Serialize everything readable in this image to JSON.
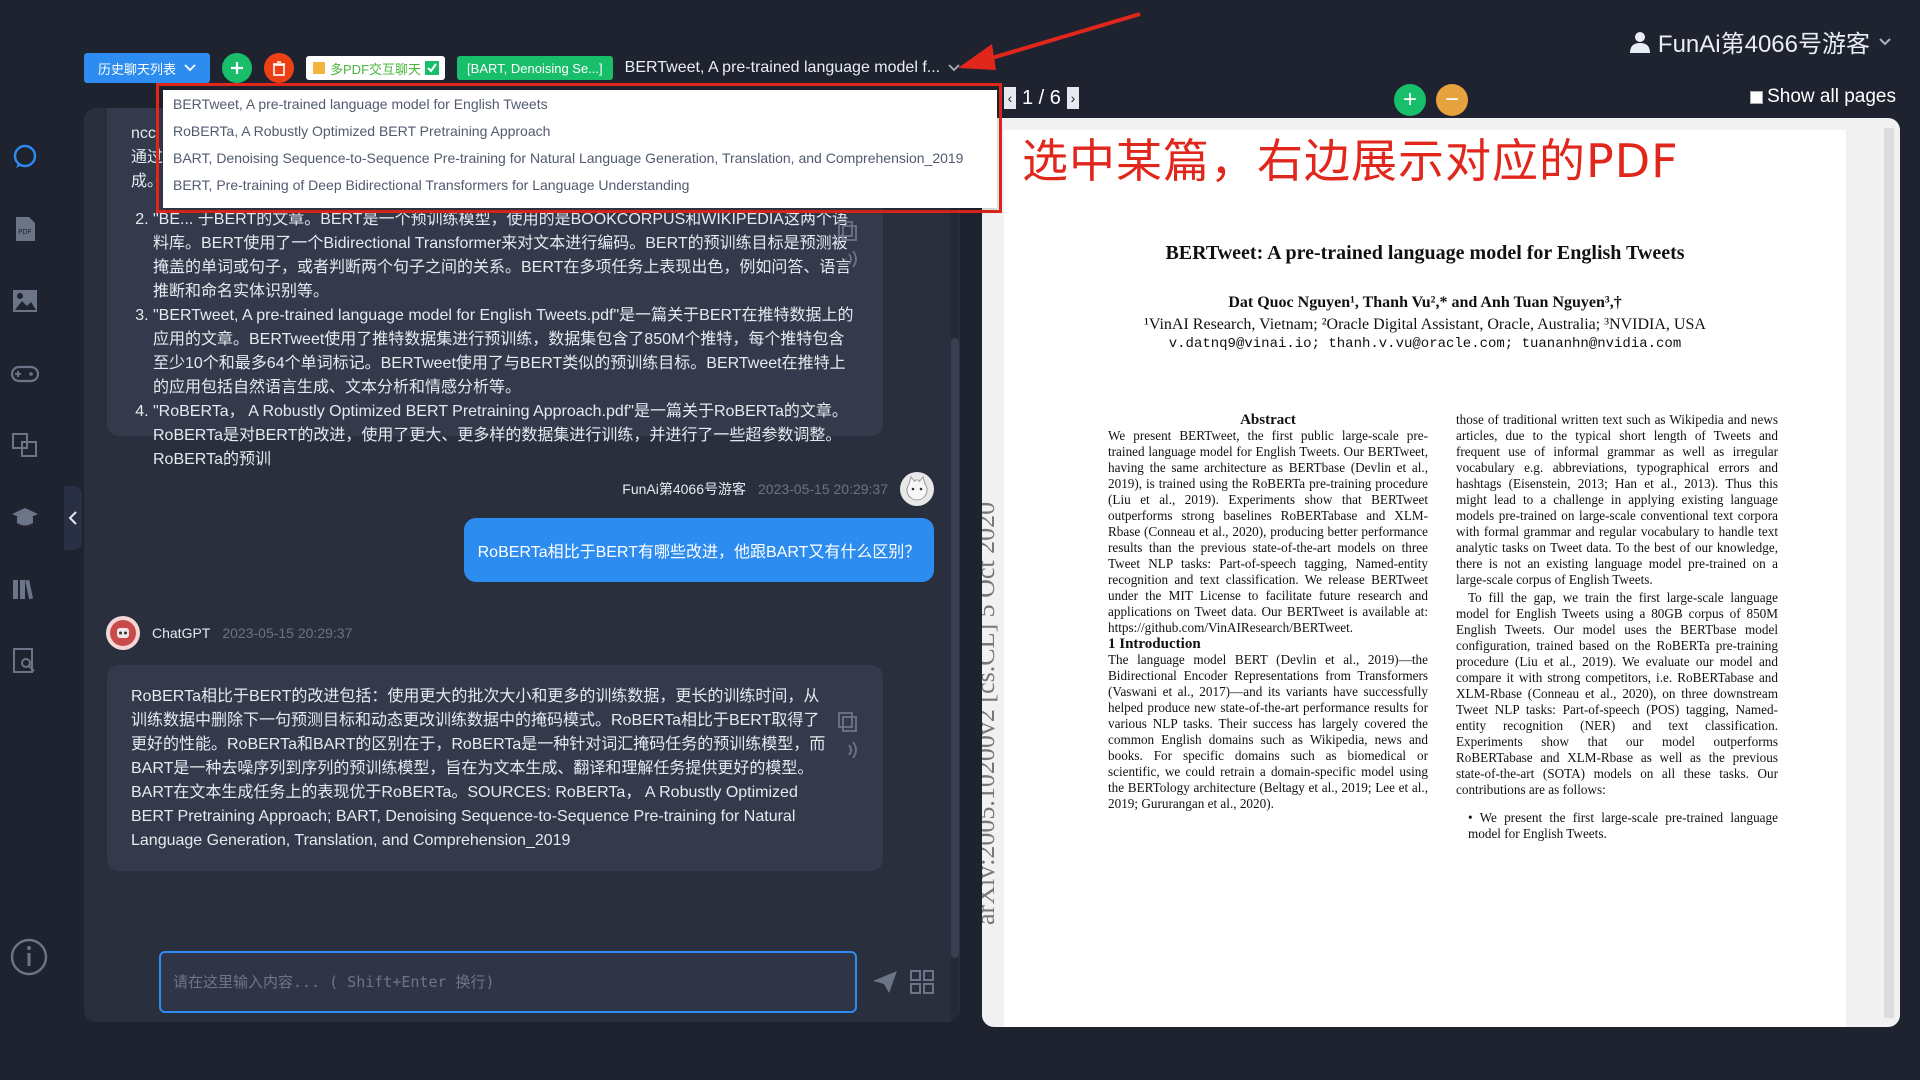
{
  "user": {
    "name": "FunAi第4066号游客"
  },
  "toolbar": {
    "history_label": "历史聊天列表",
    "tag_multi": "多PDF交互聊天",
    "tag_selected": "[BART, Denoising Se...]",
    "select_value": "BERTweet, A pre-trained language model f..."
  },
  "dropdown": {
    "options": [
      "BERTweet, A pre-trained language model for English Tweets",
      "RoBERTa,  A Robustly Optimized BERT Pretraining Approach",
      "BART, Denoising Sequence-to-Sequence Pre-training for Natural Language Generation, Translation, and Comprehension_2019",
      "BERT, Pre-training of Deep Bidirectional Transformers for Language Understanding"
    ]
  },
  "annotation": "选中某篇，右边展示对应的PDF",
  "chat": {
    "top_bubble_lines": [
      "ncc",
      "通过",
      "成。"
    ],
    "list_items": [
      "\"BE... 于BERT的文章。BERT是一个预训练模型，使用的是BOOKCORPUS和WIKIPEDIA这两个语料库。BERT使用了一个Bidirectional Transformer来对文本进行编码。BERT的预训练目标是预测被掩盖的单词或句子，或者判断两个句子之间的关系。BERT在多项任务上表现出色，例如问答、语言推断和命名实体识别等。",
      "\"BERTweet, A pre-trained language model for English Tweets.pdf\"是一篇关于BERT在推特数据上的应用的文章。BERTweet使用了推特数据集进行预训练，数据集包含了850M个推特，每个推特包含至少10个和最多64个单词标记。BERTweet使用了与BERT类似的预训练目标。BERTweet在推特上的应用包括自然语言生成、文本分析和情感分析等。",
      "\"RoBERTa， A Robustly Optimized BERT Pretraining Approach.pdf\"是一篇关于RoBERTa的文章。RoBERTa是对BERT的改进，使用了更大、更多样的数据集进行训练，并进行了一些超参数调整。RoBERTa的预训"
    ],
    "user_name": "FunAi第4066号游客",
    "user_time": "2023-05-15 20:29:37",
    "user_message": "RoBERTa相比于BERT有哪些改进，他跟BART又有什么区别？",
    "bot_name": "ChatGPT",
    "bot_time": "2023-05-15 20:29:37",
    "bot_message": "RoBERTa相比于BERT的改进包括：使用更大的批次大小和更多的训练数据，更长的训练时间，从训练数据中删除下一句预测目标和动态更改训练数据中的掩码模式。RoBERTa相比于BERT取得了更好的性能。RoBERTa和BART的区别在于，RoBERTa是一种针对词汇掩码任务的预训练模型，而BART是一种去噪序列到序列的预训练模型，旨在为文本生成、翻译和理解任务提供更好的模型。BART在文本生成任务上的表现优于RoBERTa。SOURCES: RoBERTa， A Robustly Optimized BERT Pretraining Approach; BART, Denoising Sequence-to-Sequence Pre-training for Natural Language Generation, Translation, and Comprehension_2019",
    "input_placeholder": "请在这里输入内容... ( Shift+Enter 换行)"
  },
  "pdf": {
    "page_indicator": "1 / 6",
    "show_all_label": "Show all pages",
    "title": "BERTweet: A pre-trained language model for English Tweets",
    "authors": "Dat Quoc Nguyen¹, Thanh Vu²,* and Anh Tuan Nguyen³,†",
    "affiliations": "¹VinAI Research, Vietnam; ²Oracle Digital Assistant, Oracle, Australia; ³NVIDIA, USA",
    "emails": "v.datnq9@vinai.io; thanh.v.vu@oracle.com; tuananhn@nvidia.com",
    "arxiv_id": "arXiv:2005.10200v2  [cs.CL]  5 Oct 2020",
    "abstract_heading": "Abstract",
    "abstract_text": "We present BERTweet, the first public large-scale pre-trained language model for English Tweets. Our BERTweet, having the same architecture as BERTbase (Devlin et al., 2019), is trained using the RoBERTa pre-training procedure (Liu et al., 2019). Experiments show that BERTweet outperforms strong baselines RoBERTabase and XLM-Rbase (Conneau et al., 2020), producing better performance results than the previous state-of-the-art models on three Tweet NLP tasks: Part-of-speech tagging, Named-entity recognition and text classification. We release BERTweet under the MIT License to facilitate future research and applications on Tweet data. Our BERTweet is available at: https://github.com/VinAIResearch/BERTweet.",
    "intro_heading": "1   Introduction",
    "intro_text": "The language model BERT (Devlin et al., 2019)—the Bidirectional Encoder Representations from Transformers (Vaswani et al., 2017)—and its variants have successfully helped produce new state-of-the-art performance results for various NLP tasks. Their success has largely covered the common English domains such as Wikipedia, news and books. For specific domains such as biomedical or scientific, we could retrain a domain-specific model using the BERTology architecture (Beltagy et al., 2019; Lee et al., 2019; Gururangan et al., 2020).",
    "right_col_1": "those of traditional written text such as Wikipedia and news articles, due to the typical short length of Tweets and frequent use of informal grammar as well as irregular vocabulary e.g. abbreviations, typographical errors and hashtags (Eisenstein, 2013; Han et al., 2013). Thus this might lead to a challenge in applying existing language models pre-trained on large-scale conventional text corpora with formal grammar and regular vocabulary to handle text analytic tasks on Tweet data. To the best of our knowledge, there is not an existing language model pre-trained on a large-scale corpus of English Tweets.",
    "right_col_2": "To fill the gap, we train the first large-scale language model for English Tweets using a 80GB corpus of 850M English Tweets. Our model uses the BERTbase model configuration, trained based on the RoBERTa pre-training procedure (Liu et al., 2019). We evaluate our model and compare it with strong competitors, i.e. RoBERTabase and XLM-Rbase (Conneau et al., 2020), on three downstream Tweet NLP tasks: Part-of-speech (POS) tagging, Named-entity recognition (NER) and text classification. Experiments show that our model outperforms RoBERTabase and XLM-Rbase as well as the previous state-of-the-art (SOTA) models on all these tasks. Our contributions are as follows:",
    "right_col_bullet": "We present the first large-scale pre-trained language model for English Tweets."
  }
}
